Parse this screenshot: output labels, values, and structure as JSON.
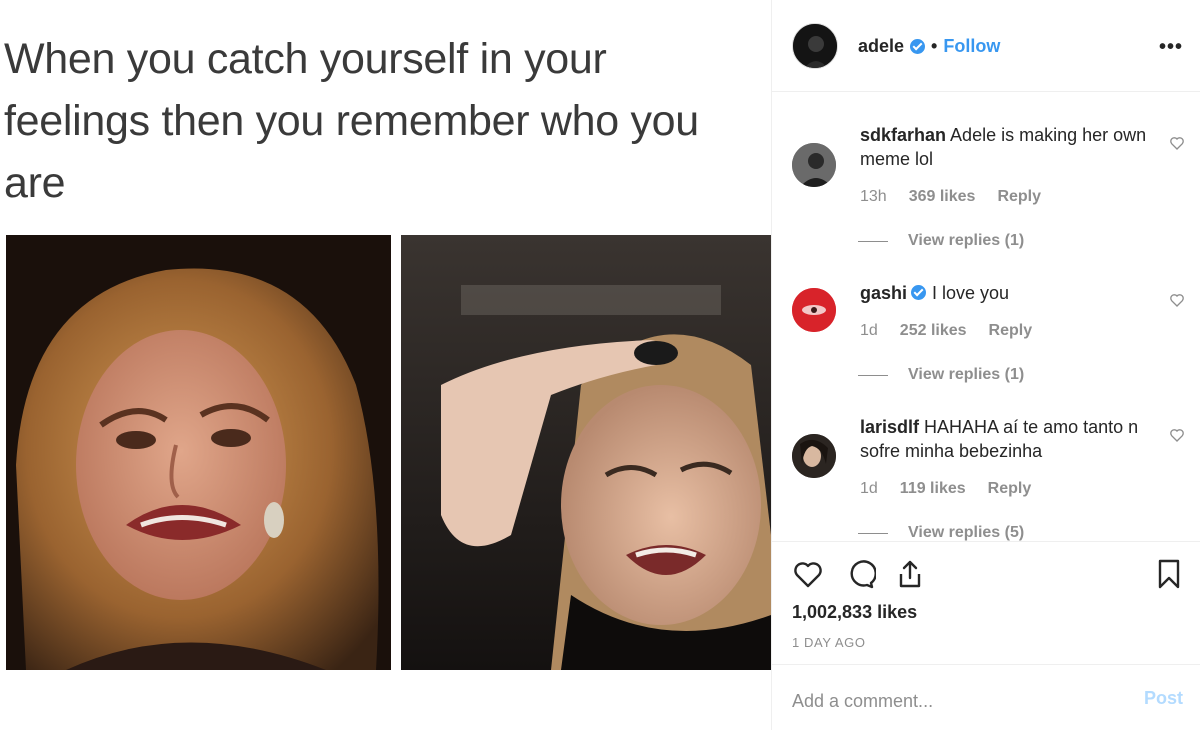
{
  "post": {
    "caption_lines": [
      "When you catch yourself in your",
      "feelings then you remember who you",
      "are"
    ]
  },
  "header": {
    "username": "adele",
    "separator": "•",
    "follow_label": "Follow",
    "more_label": "•••"
  },
  "comments": [
    {
      "username": "sdkfarhan",
      "verified": false,
      "text": "Adele is making her own meme lol",
      "time": "13h",
      "likes": "369 likes",
      "reply_label": "Reply",
      "view_replies": "View replies (1)"
    },
    {
      "username": "gashi",
      "verified": true,
      "text": "I love you",
      "time": "1d",
      "likes": "252 likes",
      "reply_label": "Reply",
      "view_replies": "View replies (1)"
    },
    {
      "username": "larisdlf",
      "verified": false,
      "text": "HAHAHA aí te amo tanto n sofre minha bebezinha",
      "time": "1d",
      "likes": "119 likes",
      "reply_label": "Reply",
      "view_replies": "View replies (5)"
    }
  ],
  "actions": {
    "icons": [
      "heart-icon",
      "comment-icon",
      "share-icon",
      "bookmark-icon"
    ],
    "like_count": "1,002,833 likes",
    "timestamp": "1 DAY AGO"
  },
  "comment_box": {
    "placeholder": "Add a comment...",
    "post_label": "Post"
  },
  "colors": {
    "accent": "#3897f0",
    "text": "#262626",
    "muted": "#8e8e8e",
    "post_disabled": "#b3dbff",
    "border": "#efefef"
  }
}
